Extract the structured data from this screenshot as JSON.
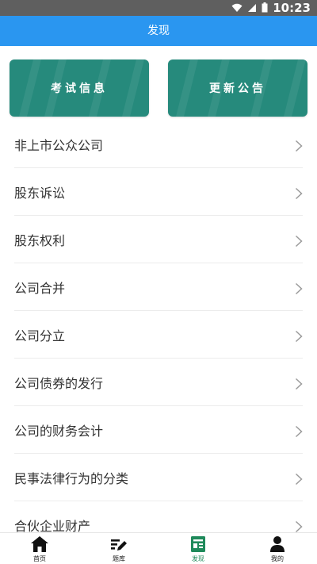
{
  "status_bar": {
    "time": "10:23"
  },
  "header": {
    "title": "发现"
  },
  "cards": [
    {
      "label": "考试信息"
    },
    {
      "label": "更新公告"
    }
  ],
  "list": {
    "items": [
      {
        "label": "非上市公众公司"
      },
      {
        "label": "股东诉讼"
      },
      {
        "label": "股东权利"
      },
      {
        "label": "公司合并"
      },
      {
        "label": "公司分立"
      },
      {
        "label": "公司债券的发行"
      },
      {
        "label": "公司的财务会计"
      },
      {
        "label": "民事法律行为的分类"
      },
      {
        "label": "合伙企业财产"
      }
    ]
  },
  "tabbar": {
    "tabs": [
      {
        "label": "首页",
        "icon": "home-icon"
      },
      {
        "label": "题库",
        "icon": "edit-list-icon"
      },
      {
        "label": "发现",
        "icon": "discover-icon",
        "active": true
      },
      {
        "label": "我的",
        "icon": "user-icon"
      }
    ]
  },
  "colors": {
    "header": "#2a96f0",
    "card": "#268a7c",
    "active_tab": "#1f8a5b"
  }
}
